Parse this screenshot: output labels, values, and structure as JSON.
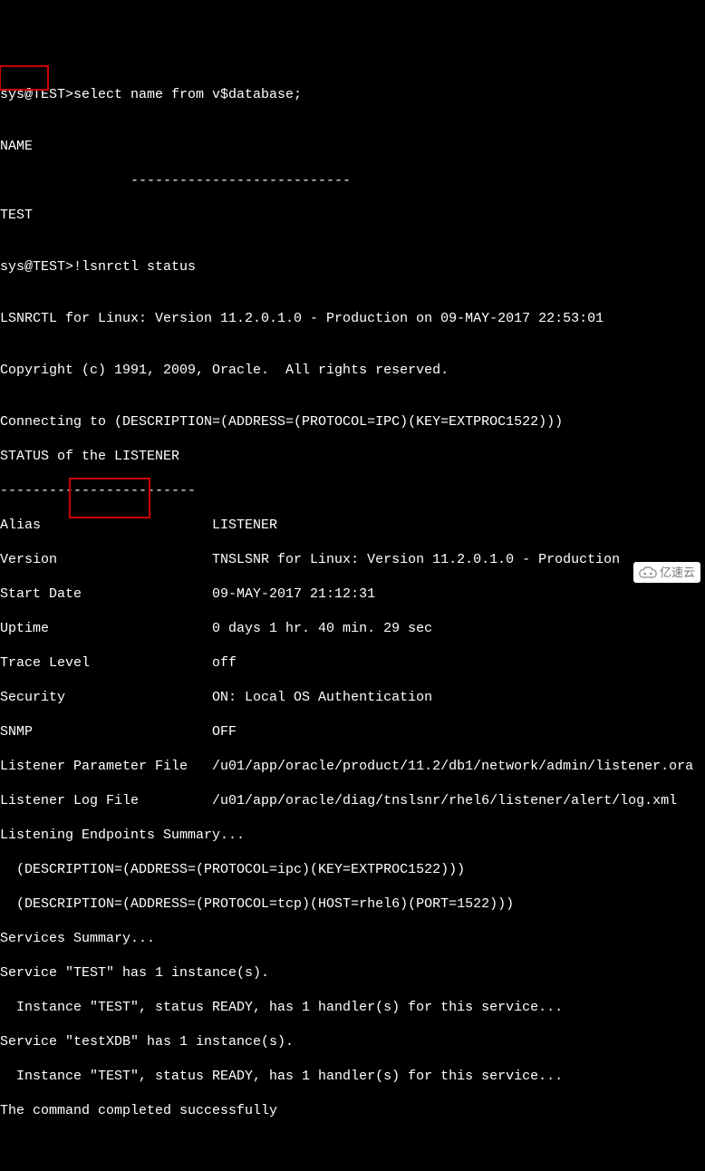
{
  "lines": {
    "l0": "sys@TEST>select name from v$database;",
    "l1": "",
    "l2": "NAME",
    "l3": "                ---------------------------",
    "l4": "TEST",
    "l5": "",
    "l6": "sys@TEST>!lsnrctl status",
    "l7": "",
    "l8": "LSNRCTL for Linux: Version 11.2.0.1.0 - Production on 09-MAY-2017 22:53:01",
    "l9": "",
    "l10": "Copyright (c) 1991, 2009, Oracle.  All rights reserved.",
    "l11": "",
    "l12": "Connecting to (DESCRIPTION=(ADDRESS=(PROTOCOL=IPC)(KEY=EXTPROC1522)))",
    "l13": "STATUS of the LISTENER",
    "l14": "------------------------",
    "l15": "Alias                     LISTENER",
    "l16": "Version                   TNSLSNR for Linux: Version 11.2.0.1.0 - Production",
    "l17": "Start Date                09-MAY-2017 21:12:31",
    "l18": "Uptime                    0 days 1 hr. 40 min. 29 sec",
    "l19": "Trace Level               off",
    "l20": "Security                  ON: Local OS Authentication",
    "l21": "SNMP                      OFF",
    "l22": "Listener Parameter File   /u01/app/oracle/product/11.2/db1/network/admin/listener.ora",
    "l23": "Listener Log File         /u01/app/oracle/diag/tnslsnr/rhel6/listener/alert/log.xml",
    "l24": "Listening Endpoints Summary...",
    "l25": "  (DESCRIPTION=(ADDRESS=(PROTOCOL=ipc)(KEY=EXTPROC1522)))",
    "l26": "  (DESCRIPTION=(ADDRESS=(PROTOCOL=tcp)(HOST=rhel6)(PORT=1522)))",
    "l27": "Services Summary...",
    "l28": "Service \"TEST\" has 1 instance(s).",
    "l29": "  Instance \"TEST\", status READY, has 1 handler(s) for this service...",
    "l30": "Service \"testXDB\" has 1 instance(s).",
    "l31": "  Instance \"TEST\", status READY, has 1 handler(s) for this service...",
    "l32": "The command completed successfully"
  },
  "watermark": {
    "text": "亿速云"
  }
}
